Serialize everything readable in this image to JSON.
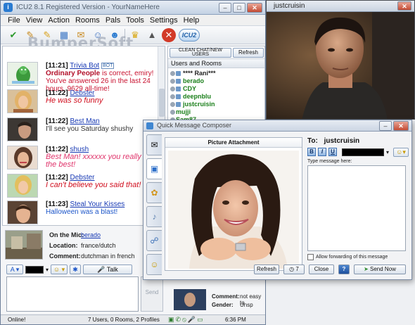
{
  "main_window": {
    "title": "ICU2 8.1 Registered Version - YourNameHere",
    "menu": [
      "File",
      "View",
      "Action",
      "Rooms",
      "Pals",
      "Tools",
      "Settings",
      "Help"
    ],
    "brand_badge": "ICU2"
  },
  "watermark": "BumperSoft",
  "chat": {
    "messages": [
      {
        "time": "[11:21]",
        "nick": "Trivia Bot",
        "badge": "BOT",
        "line1_bold": "Ordinary People",
        "line1_rest": " is correct, emiry!",
        "line2": "You've answered 26 in the last 24 hours, 9629 all-time!"
      },
      {
        "time": "[11:22]",
        "nick": "Debster",
        "text": "He was so funny"
      },
      {
        "time": "[11:22]",
        "nick": "Best Man",
        "text": "I'll see you Saturday shushy"
      },
      {
        "time": "[11:22]",
        "nick": "shush",
        "text": "Best Man! xxxxxx you really are the best!"
      },
      {
        "time": "[11:22]",
        "nick": "Debster",
        "text": "I can't believe you said that!"
      },
      {
        "time": "[11:23]",
        "nick": "Steal Your Kisses",
        "text": "Halloween was a blast!"
      }
    ]
  },
  "users_panel": {
    "clean_button": "CLEAN CHAT/NEW USERS",
    "refresh_button": "Refresh",
    "header": "Users and Rooms",
    "users": [
      "**** Rani***",
      "berado",
      "CDY",
      "deepnblu",
      "justcruisin",
      "mujji",
      "Sam87"
    ]
  },
  "profile": {
    "on_mic_label": "On the Mic:",
    "on_mic_value": "berado",
    "location_label": "Location:",
    "location_value": "france/dutch",
    "comment_label": "Comment:",
    "comment_value": "dutchman in french"
  },
  "compose": {
    "font_button": "A",
    "talk_button": "Talk",
    "send_button": "Send"
  },
  "lower_right": {
    "comment_label": "Comment:",
    "comment_value": "not easy to",
    "gender_label": "Gender:",
    "gender_value": "Unsp"
  },
  "status_bar": {
    "state": "Online!",
    "counts": "7 Users, 0 Rooms, 2 Profiles",
    "time": "6:36 PM"
  },
  "webcam": {
    "title": "justcruisin"
  },
  "quick_message": {
    "title": "Quick Message Composer",
    "picture_header": "Picture Attachment",
    "to_label": "To:",
    "to_value": "justcruisin",
    "type_label": "Type message here:",
    "forward_label": "Allow forwarding of this message",
    "refresh_button": "Refresh",
    "timer_value": "7",
    "close_button": "Close",
    "help_button": "?",
    "send_button": "Send Now"
  }
}
